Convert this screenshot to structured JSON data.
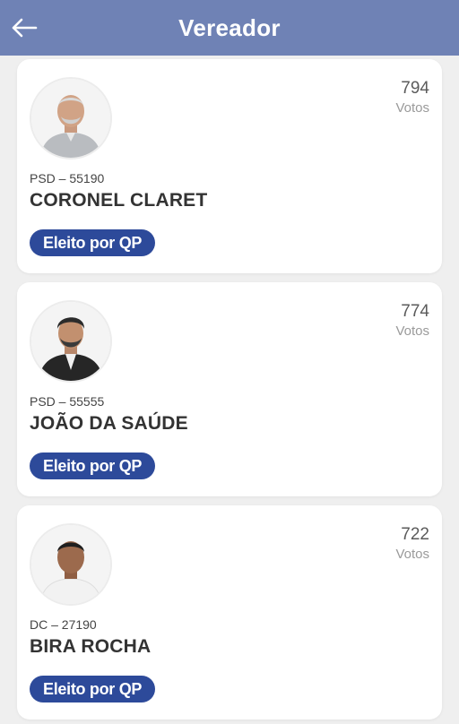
{
  "header": {
    "title": "Vereador",
    "back_icon": "arrow-left-icon"
  },
  "colors": {
    "header_bg": "#6f82b5",
    "badge_bg": "#2d4a9a",
    "page_bg": "#efefef"
  },
  "candidates": [
    {
      "votes": "794",
      "votes_label": "Votos",
      "party": "PSD – 55190",
      "name": "CORONEL CLARET",
      "status": "Eleito por QP"
    },
    {
      "votes": "774",
      "votes_label": "Votos",
      "party": "PSD – 55555",
      "name": "JOÃO DA SAÚDE",
      "status": "Eleito por QP"
    },
    {
      "votes": "722",
      "votes_label": "Votos",
      "party": "DC – 27190",
      "name": "BIRA ROCHA",
      "status": "Eleito por QP"
    }
  ]
}
